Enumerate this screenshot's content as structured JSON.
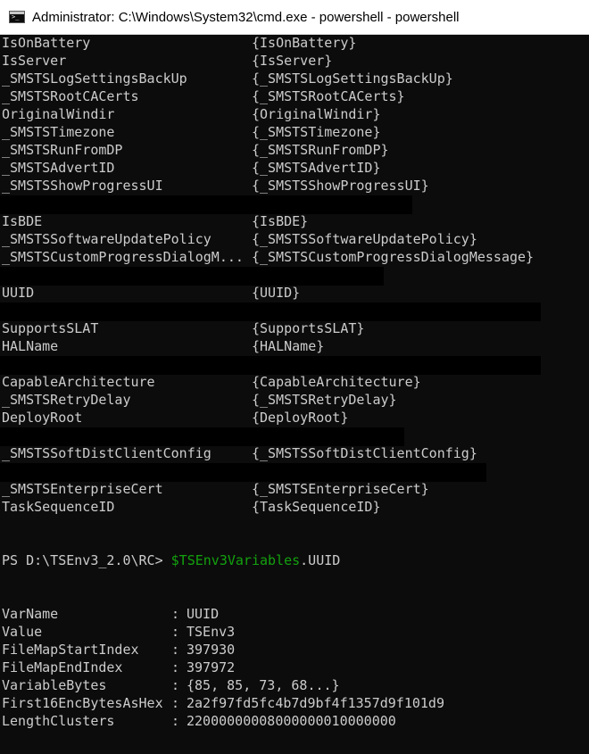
{
  "window": {
    "title": "Administrator: C:\\Windows\\System32\\cmd.exe - powershell - powershell",
    "icon": "cmd-console-icon"
  },
  "table_rows": [
    {
      "name": "IsOnBattery",
      "value": "{IsOnBattery}"
    },
    {
      "name": "IsServer",
      "value": "{IsServer}"
    },
    {
      "name": "_SMSTSLogSettingsBackUp",
      "value": "{_SMSTSLogSettingsBackUp}"
    },
    {
      "name": "_SMSTSRootCACerts",
      "value": "{_SMSTSRootCACerts}"
    },
    {
      "name": "OriginalWindir",
      "value": "{OriginalWindir}"
    },
    {
      "name": "_SMSTSTimezone",
      "value": "{_SMSTSTimezone}"
    },
    {
      "name": "_SMSTSRunFromDP",
      "value": "{_SMSTSRunFromDP}"
    },
    {
      "name": "_SMSTSAdvertID",
      "value": "{_SMSTSAdvertID}"
    },
    {
      "name": "_SMSTSShowProgressUI",
      "value": "{_SMSTSShowProgressUI}"
    },
    {
      "name": "IsBDE",
      "value": "{IsBDE}"
    },
    {
      "name": "_SMSTSSoftwareUpdatePolicy",
      "value": "{_SMSTSSoftwareUpdatePolicy}"
    },
    {
      "name": "_SMSTSCustomProgressDialogM...",
      "value": "{_SMSTSCustomProgressDialogMessage}"
    },
    {
      "name": "UUID",
      "value": "{UUID}"
    },
    {
      "name": "SupportsSLAT",
      "value": "{SupportsSLAT}"
    },
    {
      "name": "HALName",
      "value": "{HALName}"
    },
    {
      "name": "CapableArchitecture",
      "value": "{CapableArchitecture}"
    },
    {
      "name": "_SMSTSRetryDelay",
      "value": "{_SMSTSRetryDelay}"
    },
    {
      "name": "DeployRoot",
      "value": "{DeployRoot}"
    },
    {
      "name": "_SMSTSSoftDistClientConfig",
      "value": "{_SMSTSSoftDistClientConfig}"
    },
    {
      "name": "_SMSTSEnterpriseCert",
      "value": "{_SMSTSEnterpriseCert}"
    },
    {
      "name": "TaskSequenceID",
      "value": "{TaskSequenceID}"
    }
  ],
  "prompt": {
    "path": "PS D:\\TSEnv3_2.0\\RC> ",
    "variable": "$TSEnv3Variables",
    "member": ".UUID"
  },
  "result": [
    {
      "name": "VarName",
      "sep": ":",
      "value": "UUID"
    },
    {
      "name": "Value",
      "sep": ":",
      "value": "TSEnv3"
    },
    {
      "name": "FileMapStartIndex",
      "sep": ":",
      "value": "397930"
    },
    {
      "name": "FileMapEndIndex",
      "sep": ":",
      "value": "397972"
    },
    {
      "name": "VariableBytes",
      "sep": ":",
      "value": "{85, 85, 73, 68...}"
    },
    {
      "name": "First16EncBytesAsHex",
      "sep": ":",
      "value": "2a2f97fd5fc4b7d9bf4f1357d9f101d9"
    },
    {
      "name": "LengthClusters",
      "sep": ":",
      "value": "22000000008000000010000000"
    }
  ],
  "colors": {
    "background": "#0c0c0c",
    "text": "#cccccc",
    "variable": "#13a10e",
    "redaction": "#000000"
  }
}
